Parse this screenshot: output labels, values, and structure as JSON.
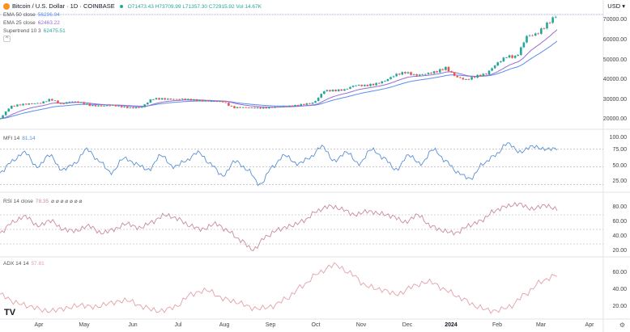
{
  "header": {
    "title": "Bitcoin / U.S. Dollar · 1D · COINBASE",
    "open": "O71473.43",
    "high": "H73709.99",
    "low": "L71357.30",
    "close": "C72915.92",
    "volume": "Vol 14.67K"
  },
  "legends": {
    "ema50": {
      "label": "EMA 50 close",
      "value": "56296.04"
    },
    "ema25": {
      "label": "EMA 25 close",
      "value": "62463.22"
    },
    "supertrend": {
      "label": "Supertrend 10 3",
      "value": "62475.51"
    },
    "mfi": {
      "label": "MFI 14",
      "value": "81.14"
    },
    "rsi": {
      "label": "RSI 14 close",
      "value": "78.35",
      "extra": "⌀ ⌀ ⌀ ⌀ ⌀ ⌀ ⌀"
    },
    "adx": {
      "label": "ADX 14 14",
      "value": "57.81"
    }
  },
  "currency": "USD",
  "price_axis": [
    "70000.00",
    "60000.00",
    "50000.00",
    "40000.00",
    "30000.00",
    "20000.00"
  ],
  "mfi_axis": [
    "100.00",
    "75.00",
    "50.00",
    "25.00"
  ],
  "rsi_axis": [
    "80.00",
    "60.00",
    "40.00",
    "20.00"
  ],
  "adx_axis": [
    "60.00",
    "40.00",
    "20.00"
  ],
  "time_axis": [
    "Apr",
    "May",
    "Jun",
    "Jul",
    "Aug",
    "Sep",
    "Oct",
    "Nov",
    "Dec",
    "2024",
    "Feb",
    "Mar",
    "Apr"
  ],
  "colors": {
    "up": "#26a69a",
    "down": "#ef5350",
    "ema50": "#5b8def",
    "ema25": "#9c6bd0",
    "mfi": "#5a8fd6",
    "rsi": "#c98b9b",
    "adx": "#e3a0a8"
  },
  "chart_data": {
    "type": "candlestick",
    "title": "Bitcoin / U.S. Dollar · 1D · COINBASE",
    "weekly_close": [
      20500,
      26500,
      27500,
      28000,
      28300,
      30300,
      27800,
      29200,
      28500,
      27000,
      26800,
      27200,
      26500,
      25800,
      26300,
      30500,
      30400,
      30200,
      30300,
      29900,
      29400,
      29200,
      29000,
      26000,
      26100,
      25900,
      25800,
      26200,
      26600,
      26900,
      27700,
      28500,
      34500,
      34600,
      35000,
      37300,
      37100,
      37800,
      39500,
      42500,
      43800,
      42200,
      43000,
      44000,
      46000,
      41500,
      40000,
      41800,
      43000,
      48000,
      51800,
      51500,
      62000,
      63000,
      68000,
      72900
    ],
    "ylim": [
      17000,
      75000
    ],
    "mfi": [
      40,
      60,
      75,
      50,
      70,
      45,
      55,
      80,
      60,
      40,
      65,
      55,
      45,
      70,
      50,
      60,
      75,
      55,
      35,
      60,
      45,
      20,
      50,
      70,
      55,
      65,
      85,
      60,
      75,
      55,
      80,
      65,
      45,
      70,
      55,
      80,
      60,
      40,
      30,
      55,
      70,
      90,
      75,
      85,
      80,
      81
    ],
    "rsi": [
      45,
      60,
      68,
      55,
      62,
      50,
      48,
      55,
      45,
      50,
      58,
      52,
      60,
      70,
      65,
      55,
      50,
      58,
      48,
      35,
      22,
      40,
      50,
      55,
      62,
      75,
      82,
      78,
      70,
      75,
      72,
      68,
      60,
      70,
      55,
      48,
      45,
      55,
      62,
      75,
      82,
      85,
      78,
      83,
      78
    ],
    "adx": [
      35,
      25,
      20,
      15,
      18,
      22,
      20,
      25,
      28,
      20,
      15,
      20,
      35,
      40,
      30,
      25,
      18,
      20,
      30,
      45,
      60,
      70,
      60,
      45,
      40,
      35,
      45,
      50,
      40,
      30,
      20,
      15,
      20,
      35,
      50,
      58
    ],
    "mfi_levels": [
      80,
      50,
      20
    ],
    "rsi_levels": [
      70,
      50,
      30
    ]
  }
}
